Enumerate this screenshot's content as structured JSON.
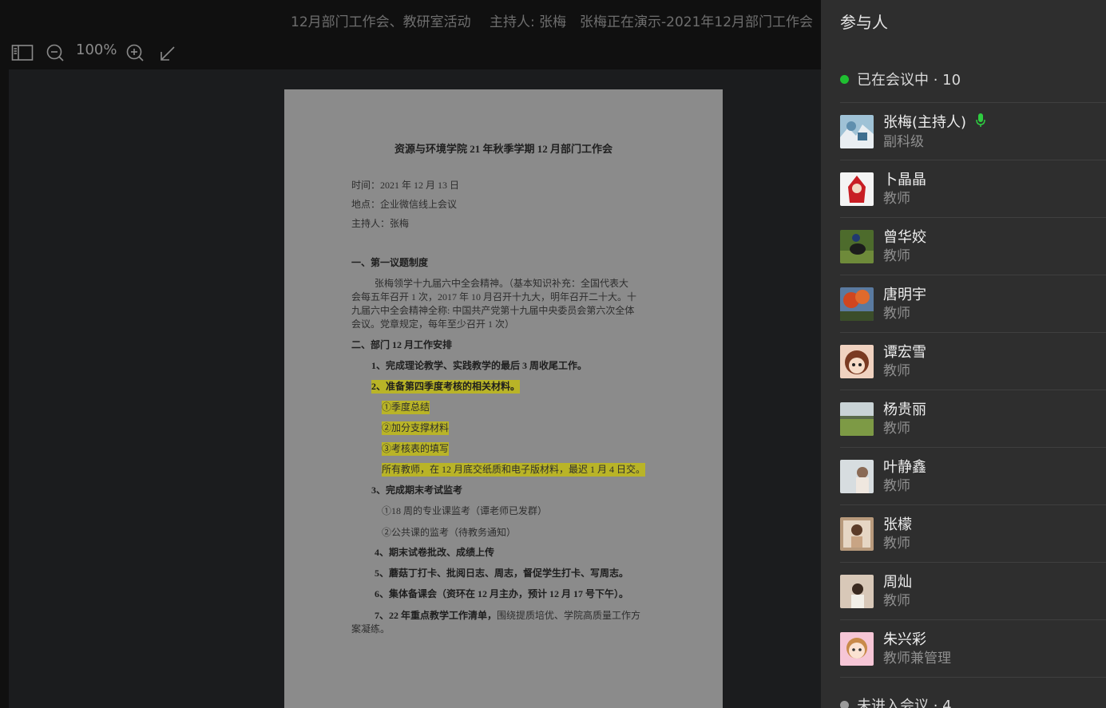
{
  "header": {
    "meeting_title": "12月部门工作会、教研室活动",
    "host": "主持人: 张梅",
    "presenting": "张梅正在演示-2021年12月部门工作会"
  },
  "toolbar": {
    "zoom": "100%",
    "icons": [
      "sidebar-toggle-icon",
      "zoom-out-icon",
      "zoom-in-icon",
      "collapse-arrow-icon"
    ]
  },
  "document": {
    "title": "资源与环境学院 21 年秋季学期 12 月部门工作会",
    "time": "时间：2021 年 12 月 13 日",
    "place": "地点：企业微信线上会议",
    "host": "主持人：张梅",
    "s1_title": "一、第一议题制度",
    "s1_p1": "张梅领学十九届六中全会精神。（基本知识补充：全国代表大",
    "s1_p2": "会每五年召开 1 次，2017 年 10 月召开十九大，明年召开二十大。十",
    "s1_p3": "九届六中全会精神全称: 中国共产党第十九届中央委员会第六次全体",
    "s1_p4": "会议。党章规定，每年至少召开 1 次）",
    "s2_title": "二、部门 12 月工作安排",
    "i1": "1、完成理论教学、实践教学的最后 3 周收尾工作。",
    "i2": "2、准备第四季度考核的相关材料。",
    "i2a": "①季度总结",
    "i2b": "②加分支撑材料",
    "i2c": "③考核表的填写",
    "i2d": "所有教师，在 12 月底交纸质和电子版材料，最迟 1 月 4 日交。",
    "i3": "3、完成期末考试监考",
    "i3a": "①18 周的专业课监考（谭老师已发群）",
    "i3b": "②公共课的监考（待教务通知）",
    "i4": "4、期末试卷批改、成绩上传",
    "i5": "5、蘑菇丁打卡、批阅日志、周志，督促学生打卡、写周志。",
    "i6": "6、集体备课会（资环在 12 月主办，预计 12 月 17 号下午）。",
    "i7_bold": "7、22 年重点教学工作清单，",
    "i7_rest": "围绕提质培优、学院高质量工作方",
    "i7_cont": "案凝练。"
  },
  "sidebar": {
    "title": "参与人",
    "in_meeting_label": "已在会议中 · 10",
    "not_joined_label": "未进入会议 · 4",
    "members": [
      {
        "name": "张梅(主持人)",
        "role": "副科级",
        "mic": true
      },
      {
        "name": "卜晶晶",
        "role": "教师"
      },
      {
        "name": "曾华姣",
        "role": "教师"
      },
      {
        "name": "唐明宇",
        "role": "教师"
      },
      {
        "name": "谭宏雪",
        "role": "教师"
      },
      {
        "name": "杨贵丽",
        "role": "教师"
      },
      {
        "name": "叶静鑫",
        "role": "教师"
      },
      {
        "name": "张檬",
        "role": "教师"
      },
      {
        "name": "周灿",
        "role": "教师"
      },
      {
        "name": "朱兴彩",
        "role": "教师兼管理"
      }
    ]
  },
  "colors": {
    "online_dot": "#1fbf31",
    "highlight": "#b9b427",
    "mic": "#2ecc40"
  }
}
